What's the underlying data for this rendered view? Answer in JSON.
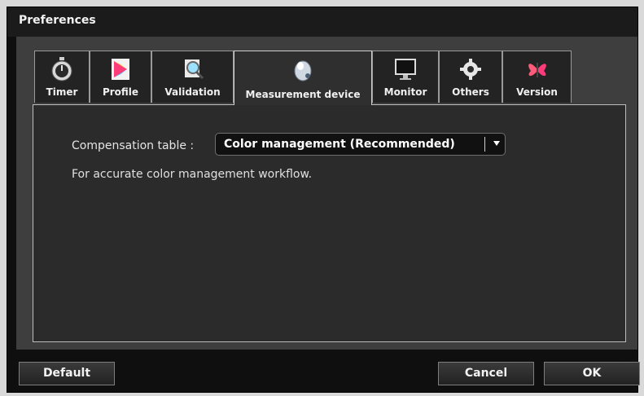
{
  "window": {
    "title": "Preferences"
  },
  "tabs": [
    {
      "label": "Timer",
      "icon": "stopwatch-icon"
    },
    {
      "label": "Profile",
      "icon": "profile-color-icon"
    },
    {
      "label": "Validation",
      "icon": "validation-magnifier-icon"
    },
    {
      "label": "Measurement device",
      "icon": "measurement-device-icon",
      "active": true
    },
    {
      "label": "Monitor",
      "icon": "monitor-icon"
    },
    {
      "label": "Others",
      "icon": "gear-icon"
    },
    {
      "label": "Version",
      "icon": "butterfly-icon"
    }
  ],
  "panel": {
    "compensation_label": "Compensation table :",
    "compensation_value": "Color management (Recommended)",
    "description": "For accurate color management workflow."
  },
  "buttons": {
    "default": "Default",
    "cancel": "Cancel",
    "ok": "OK"
  },
  "colors": {
    "accent_blue": "#2f6fb0"
  }
}
